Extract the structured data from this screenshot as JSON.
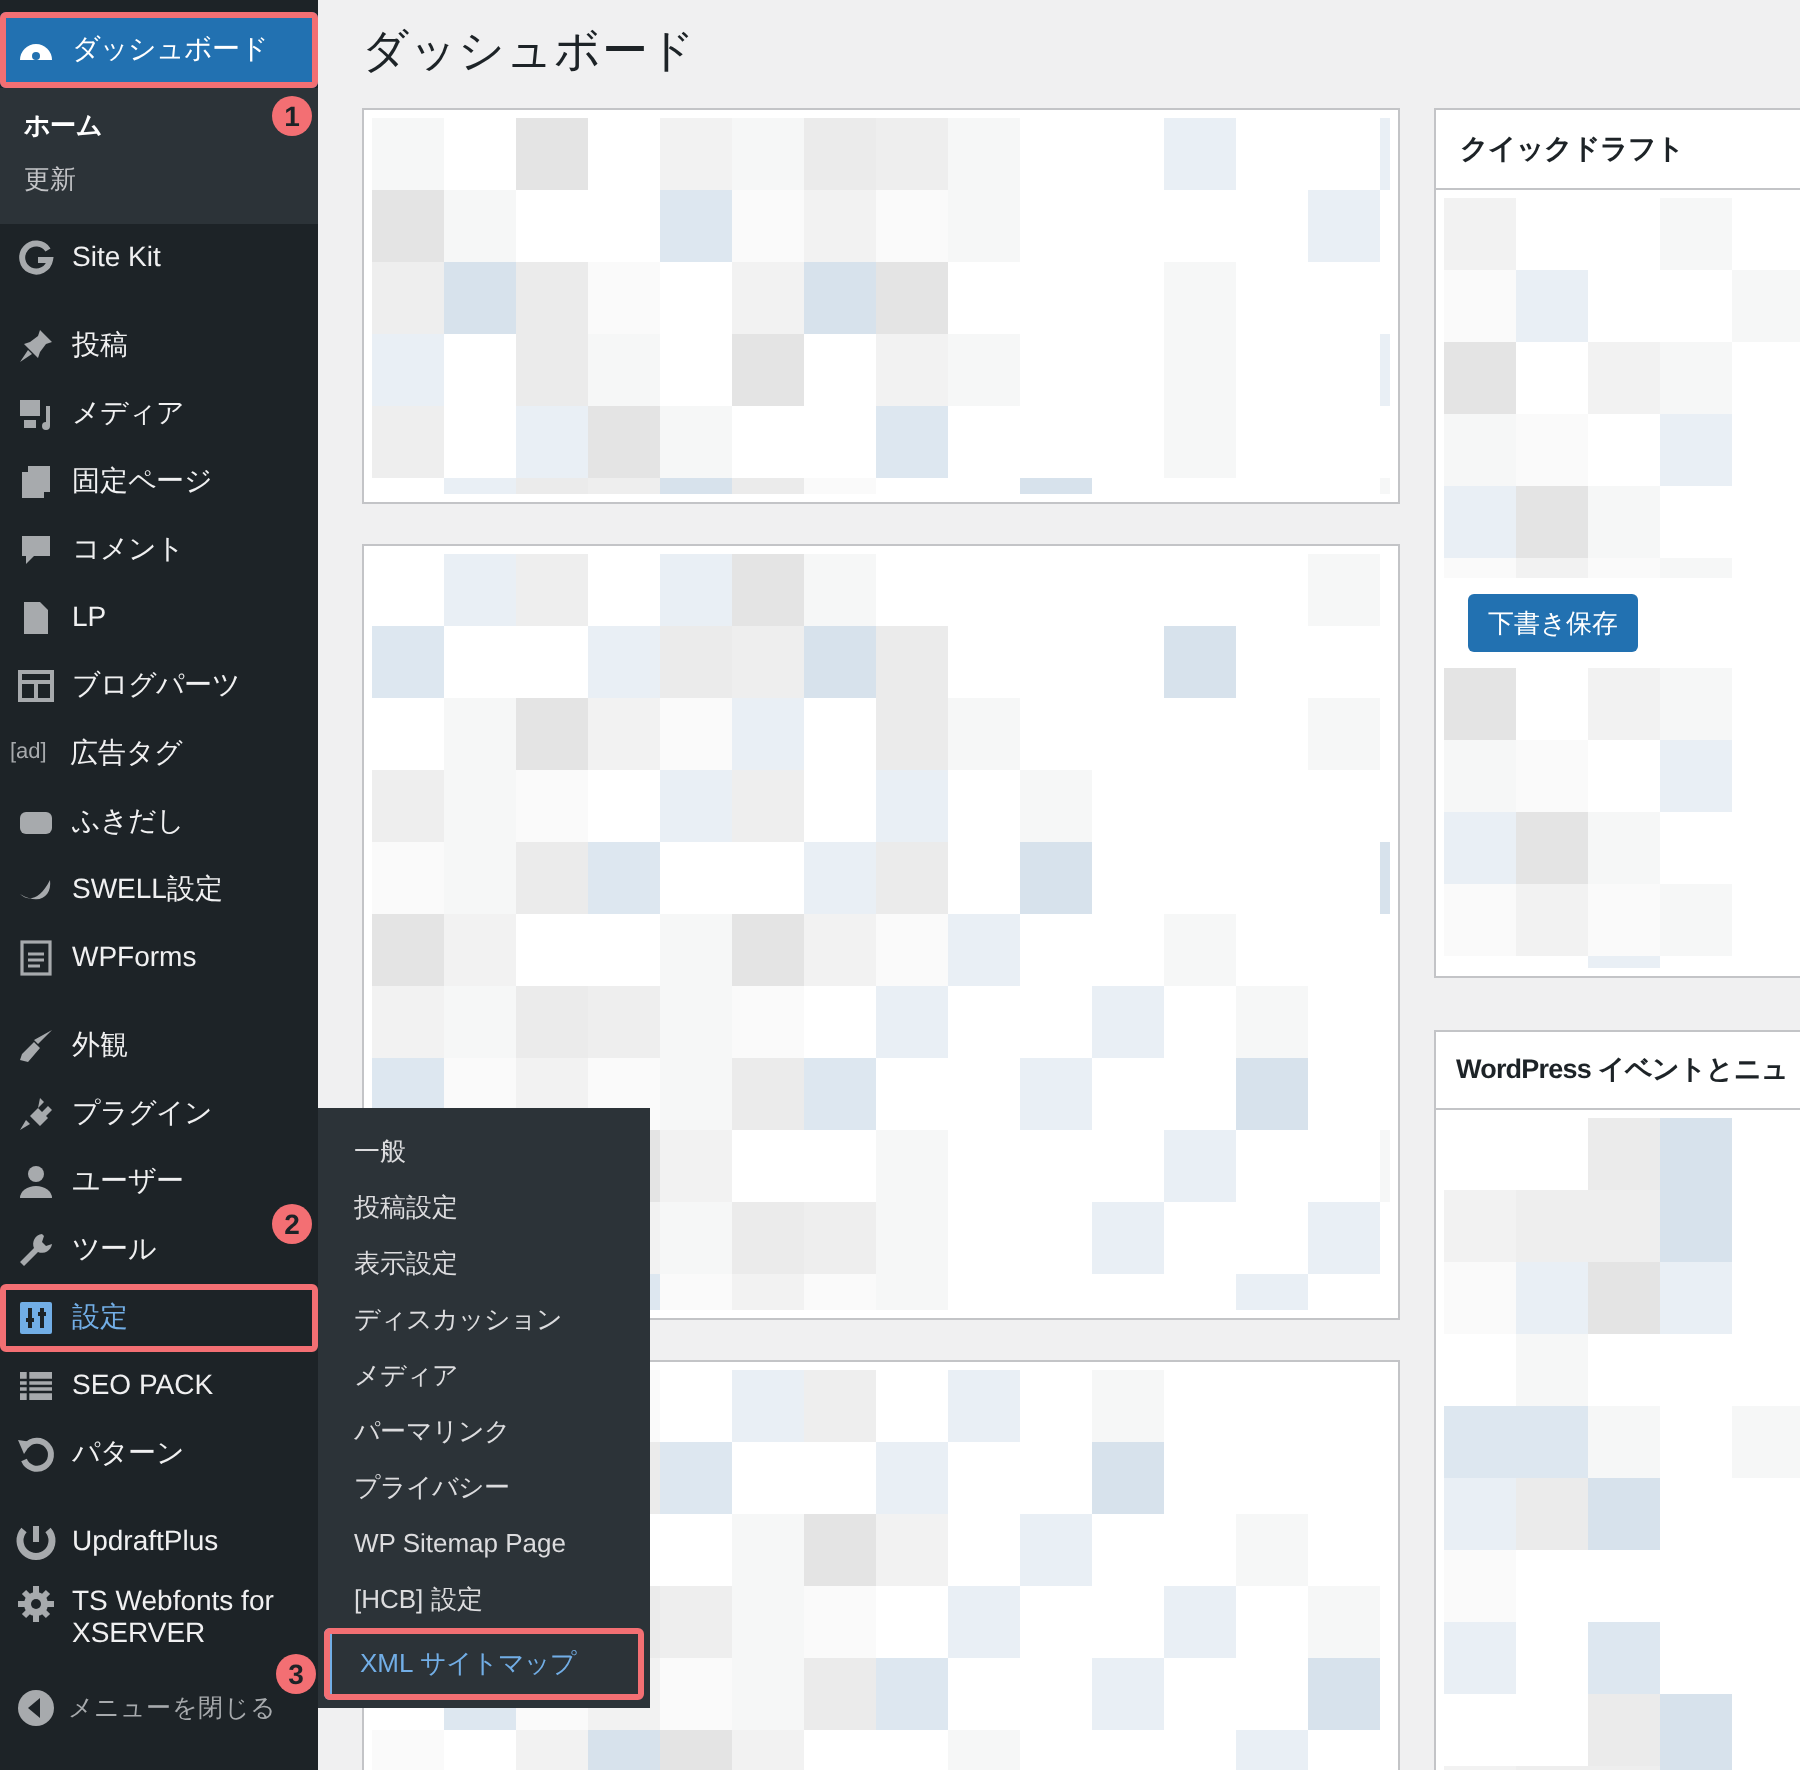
{
  "sidebar": {
    "groups": [
      [
        {
          "label": "ダッシュボード",
          "current": true,
          "open": false,
          "annotation": "1",
          "submenu": [
            {
              "label": "ホーム",
              "selected": true
            },
            {
              "label": "更新",
              "selected": false
            }
          ]
        }
      ],
      [
        {
          "label": "Site Kit",
          "current": false,
          "open": false
        }
      ],
      [
        {
          "label": "投稿",
          "current": false,
          "open": false
        },
        {
          "label": "メディア",
          "current": false,
          "open": false
        },
        {
          "label": "固定ページ",
          "current": false,
          "open": false
        },
        {
          "label": "コメント",
          "current": false,
          "open": false
        },
        {
          "label": "LP",
          "current": false,
          "open": false
        },
        {
          "label": "ブログパーツ",
          "current": false,
          "open": false
        },
        {
          "label": "広告タグ",
          "current": false,
          "open": false,
          "icon_text": "[ad]"
        },
        {
          "label": "ふきだし",
          "current": false,
          "open": false
        },
        {
          "label": "SWELL設定",
          "current": false,
          "open": false
        },
        {
          "label": "WPForms",
          "current": false,
          "open": false
        }
      ],
      [
        {
          "label": "外観",
          "current": false,
          "open": false
        },
        {
          "label": "プラグイン",
          "current": false,
          "open": false
        },
        {
          "label": "ユーザー",
          "current": false,
          "open": false
        },
        {
          "label": "ツール",
          "current": false,
          "open": false
        },
        {
          "label": "設定",
          "current": false,
          "open": true,
          "annotation": "2",
          "flyout": [
            {
              "label": "一般",
              "selected": false
            },
            {
              "label": "投稿設定",
              "selected": false
            },
            {
              "label": "表示設定",
              "selected": false
            },
            {
              "label": "ディスカッション",
              "selected": false
            },
            {
              "label": "メディア",
              "selected": false
            },
            {
              "label": "パーマリンク",
              "selected": false
            },
            {
              "label": "プライバシー",
              "selected": false
            },
            {
              "label": "WP Sitemap Page",
              "selected": false
            },
            {
              "label": "[HCB] 設定",
              "selected": false
            },
            {
              "label": "XML サイトマップ",
              "selected": true,
              "annotation": "3"
            }
          ]
        },
        {
          "label": "SEO PACK",
          "current": false,
          "open": false
        },
        {
          "label": "パターン",
          "current": false,
          "open": false
        }
      ],
      [
        {
          "label": "UpdraftPlus",
          "current": false,
          "open": false
        },
        {
          "label": "TS Webfonts for XSERVER",
          "current": false,
          "open": false
        }
      ]
    ],
    "collapse": "メニューを閉じる"
  },
  "page": {
    "title": "ダッシュボード",
    "left_widgets": [
      {
        "kind": "blurred"
      },
      {
        "kind": "blurred"
      },
      {
        "kind": "blurred"
      }
    ],
    "right_widgets": [
      {
        "title": "クイックドラフト",
        "button": "下書き保存"
      },
      {
        "title": "WordPress イベントとニュ"
      }
    ]
  }
}
